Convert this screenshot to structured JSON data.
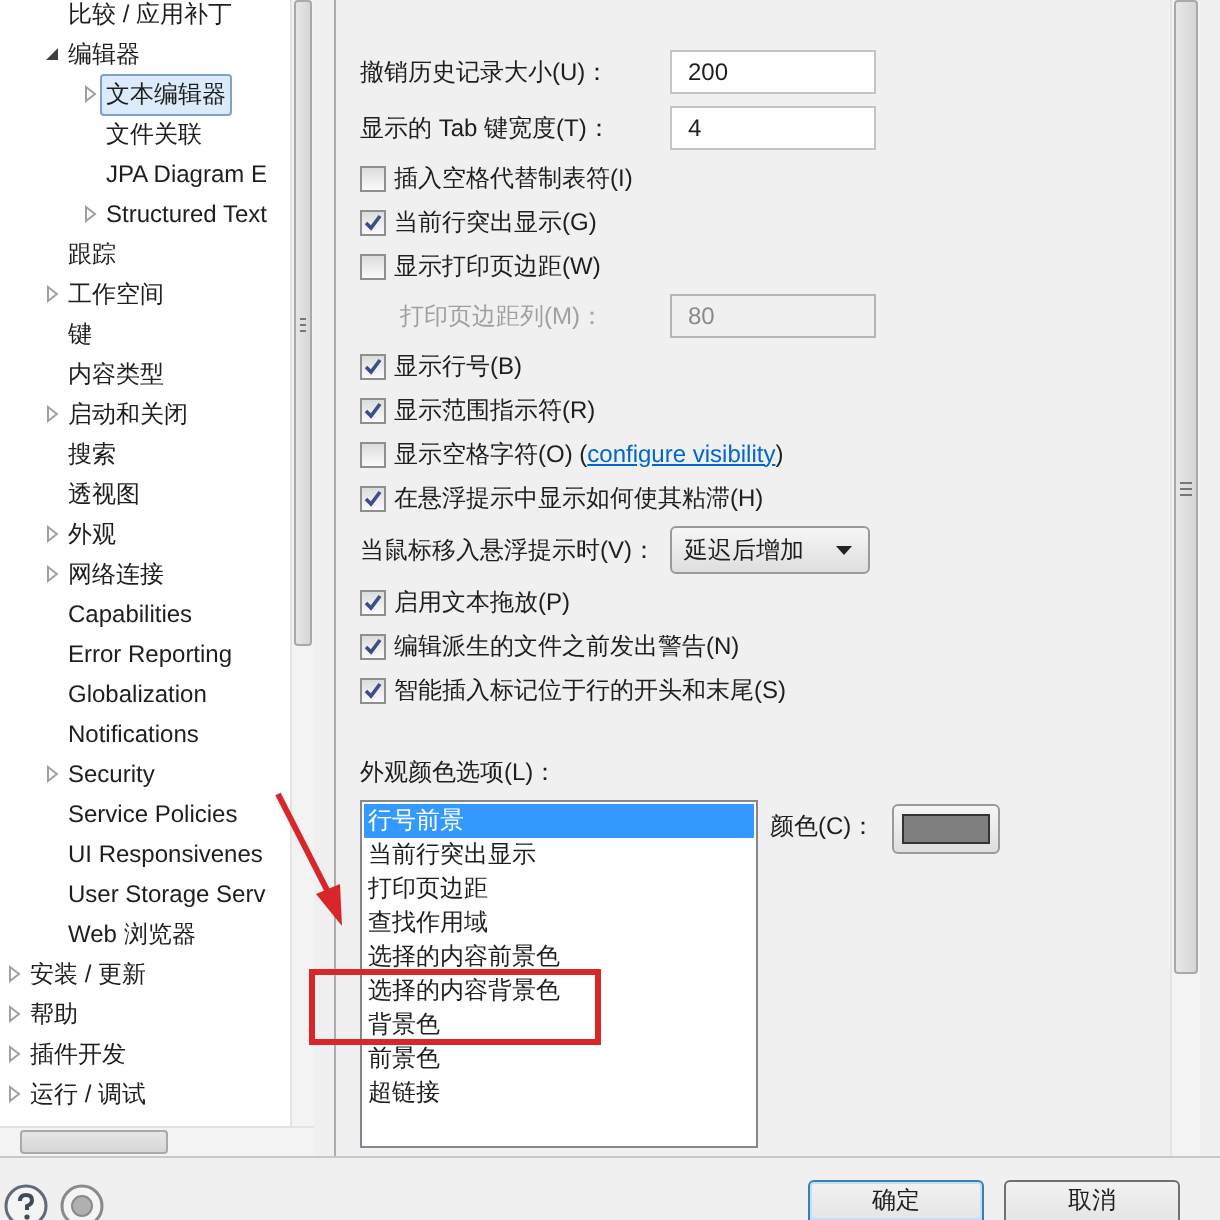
{
  "tree": {
    "items": [
      {
        "children": [
          {
            "label": "比较 / 应用补丁",
            "selected": false
          },
          {
            "label": "编辑器",
            "expanded": true,
            "selected": false,
            "children": [
              {
                "label": "文本编辑器",
                "expanded": false,
                "selected": true
              },
              {
                "label": "文件关联",
                "selected": false
              },
              {
                "label": "JPA Diagram E",
                "selected": false
              },
              {
                "label": "Structured Text",
                "expanded": false,
                "selected": false
              }
            ]
          },
          {
            "label": "跟踪",
            "selected": false
          },
          {
            "label": "工作空间",
            "expanded": false,
            "selected": false
          },
          {
            "label": "键",
            "selected": false
          },
          {
            "label": "内容类型",
            "selected": false
          },
          {
            "label": "启动和关闭",
            "expanded": false,
            "selected": false
          },
          {
            "label": "搜索",
            "selected": false
          },
          {
            "label": "透视图",
            "selected": false
          },
          {
            "label": "外观",
            "expanded": false,
            "selected": false
          },
          {
            "label": "网络连接",
            "expanded": false,
            "selected": false
          },
          {
            "label": "Capabilities",
            "selected": false
          },
          {
            "label": "Error Reporting",
            "selected": false
          },
          {
            "label": "Globalization",
            "selected": false
          },
          {
            "label": "Notifications",
            "selected": false
          },
          {
            "label": "Security",
            "expanded": false,
            "selected": false
          },
          {
            "label": "Service Policies",
            "selected": false
          },
          {
            "label": "UI Responsivenes",
            "selected": false
          },
          {
            "label": "User Storage Serv",
            "selected": false
          },
          {
            "label": "Web 浏览器",
            "selected": false
          }
        ]
      },
      {
        "label": "安装 / 更新",
        "expanded": false,
        "selected": false
      },
      {
        "label": "帮助",
        "expanded": false,
        "selected": false
      },
      {
        "label": "插件开发",
        "expanded": false,
        "selected": false
      },
      {
        "label": "运行 / 调试",
        "expanded": false,
        "selected": false
      }
    ]
  },
  "settings": [
    {
      "kind": "field",
      "label": "撤销历史记录大小(U)：",
      "value": "200",
      "disabled": false
    },
    {
      "kind": "field",
      "label": "显示的 Tab 键宽度(T)：",
      "value": "4",
      "disabled": false
    },
    {
      "kind": "checkbox",
      "label": "插入空格代替制表符(I)",
      "checked": false
    },
    {
      "kind": "checkbox",
      "label": "当前行突出显示(G)",
      "checked": true
    },
    {
      "kind": "checkbox",
      "label": "显示打印页边距(W)",
      "checked": false
    },
    {
      "kind": "field",
      "label": "打印页边距列(M)：",
      "value": "80",
      "disabled": true
    },
    {
      "kind": "checkbox",
      "label": "显示行号(B)",
      "checked": true
    },
    {
      "kind": "checkbox",
      "label": "显示范围指示符(R)",
      "checked": true
    },
    {
      "kind": "checkbox",
      "label": "显示空格字符(O) (",
      "link": "configure visibility",
      "after": ")",
      "checked": false
    },
    {
      "kind": "checkbox",
      "label": "在悬浮提示中显示如何使其粘滞(H)",
      "checked": true
    },
    {
      "kind": "dropdown",
      "label": "当鼠标移入悬浮提示时(V)：",
      "value": "延迟后增加"
    },
    {
      "kind": "checkbox",
      "label": "启用文本拖放(P)",
      "checked": true
    },
    {
      "kind": "checkbox",
      "label": "编辑派生的文件之前发出警告(N)",
      "checked": true
    },
    {
      "kind": "checkbox",
      "label": "智能插入标记位于行的开头和末尾(S)",
      "checked": true
    }
  ],
  "colors": {
    "label": "外观颜色选项(L)：",
    "items": [
      {
        "label": "行号前景",
        "selected": true
      },
      {
        "label": "当前行突出显示",
        "selected": false
      },
      {
        "label": "打印页边距",
        "selected": false
      },
      {
        "label": "查找作用域",
        "selected": false
      },
      {
        "label": "选择的内容前景色",
        "selected": false
      },
      {
        "label": "选择的内容背景色",
        "selected": false
      },
      {
        "label": "背景色",
        "selected": false
      },
      {
        "label": "前景色",
        "selected": false
      },
      {
        "label": "超链接",
        "selected": false
      }
    ],
    "color_label": "颜色(C)：",
    "color": "#7f7f7f"
  },
  "buttons": [
    "确定",
    "取消"
  ]
}
